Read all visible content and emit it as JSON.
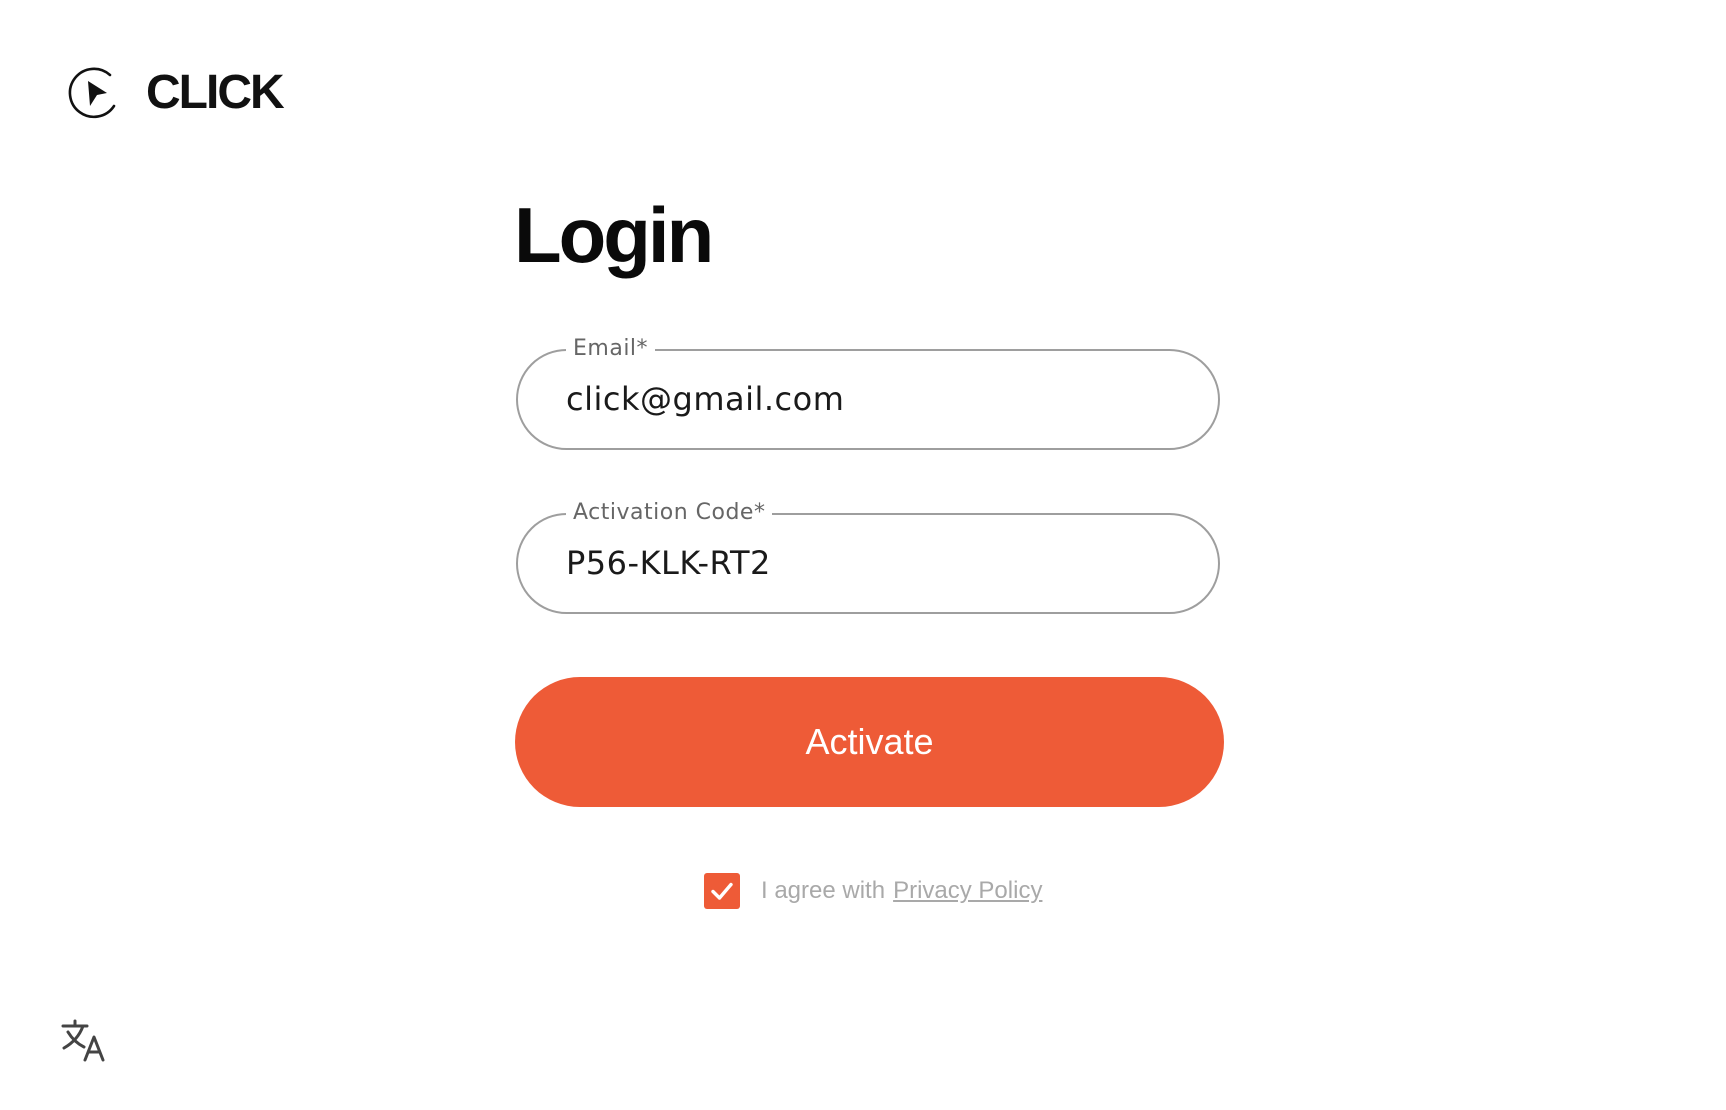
{
  "brand": {
    "name": "CLICK",
    "icon": "play-cursor-logo"
  },
  "login": {
    "title": "Login",
    "email": {
      "label": "Email*",
      "value": "click@gmail.com"
    },
    "activation_code": {
      "label": "Activation Code*",
      "value": "P56-KLK-RT2"
    },
    "activate_label": "Activate",
    "agree": {
      "checked": true,
      "text": "I agree with",
      "link_text": "Privacy Policy"
    }
  },
  "footer": {
    "translate_icon": "translate-icon"
  },
  "colors": {
    "accent": "#ee5b37",
    "field_border": "#9e9e9e",
    "muted_text": "#a9a9a9"
  }
}
